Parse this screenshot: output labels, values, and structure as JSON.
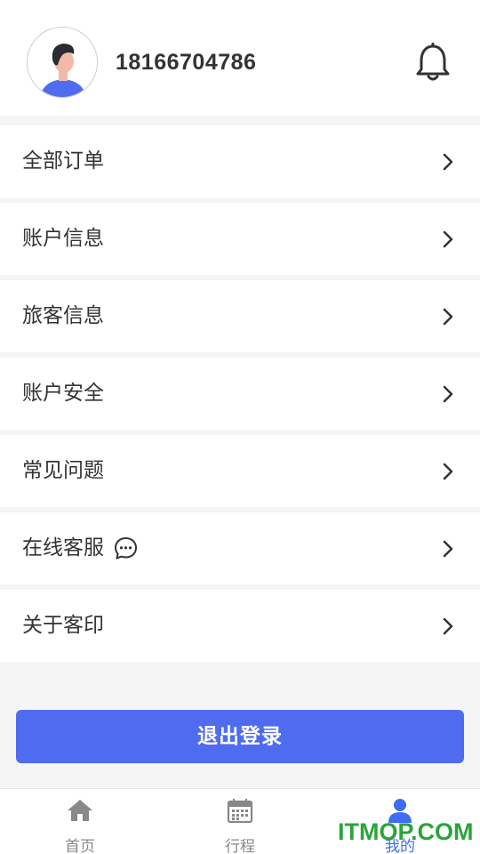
{
  "profile": {
    "phone": "18166704786",
    "avatar_icon": "user-avatar",
    "notification_icon": "bell-icon"
  },
  "menu": {
    "items": [
      {
        "label": "全部订单"
      },
      {
        "label": "账户信息"
      },
      {
        "label": "旅客信息"
      },
      {
        "label": "账户安全"
      },
      {
        "label": "常见问题"
      },
      {
        "label": "在线客服"
      },
      {
        "label": "关于客印"
      }
    ]
  },
  "logout": {
    "label": "退出登录"
  },
  "tabs": [
    {
      "label": "首页",
      "icon": "home-icon",
      "active": false
    },
    {
      "label": "行程",
      "icon": "calendar-icon",
      "active": false
    },
    {
      "label": "我的",
      "icon": "person-icon",
      "active": true
    }
  ],
  "watermark": "ITMOP.COM",
  "colors": {
    "accent": "#4f6cf0",
    "tab_active": "#3f6cf5",
    "tab_inactive": "#888888",
    "watermark": "#2aa43a"
  }
}
